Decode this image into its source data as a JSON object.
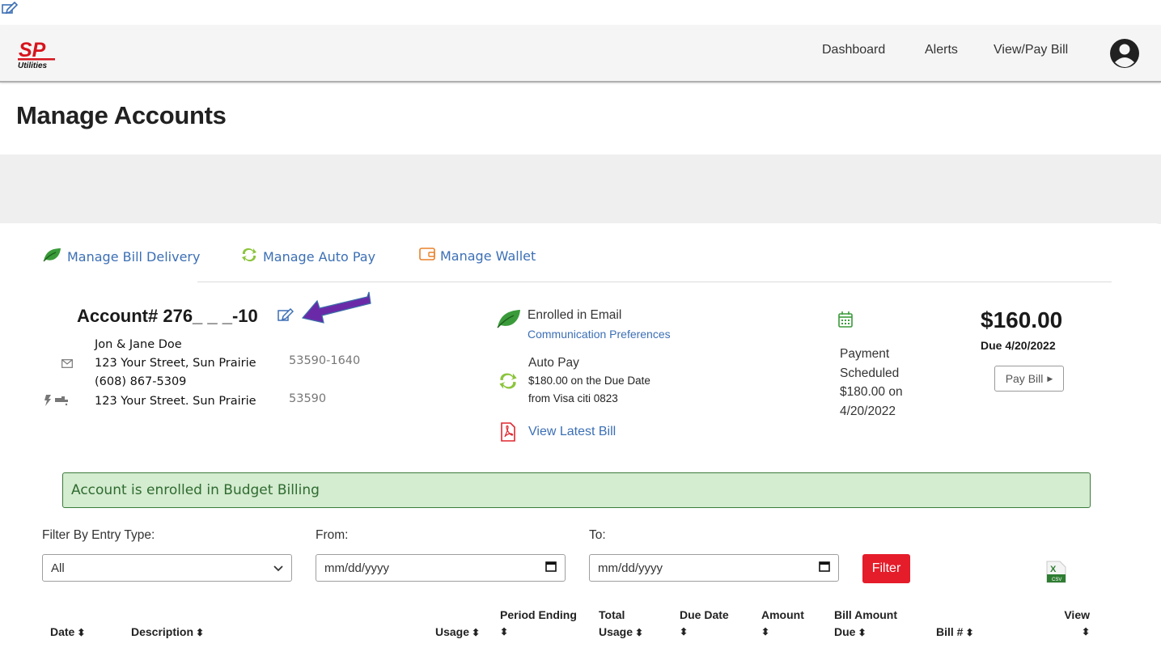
{
  "header": {
    "logo_text_top": "SP",
    "logo_text_bottom": "Utilities",
    "nav": [
      "Dashboard",
      "Alerts",
      "View/Pay Bill"
    ]
  },
  "page": {
    "title": "Manage Accounts"
  },
  "tabs": [
    "Manage Bill Delivery",
    "Manage Auto Pay",
    "Manage Wallet"
  ],
  "account": {
    "number": "Account# 276_ _ _-10",
    "name": "Jon & Jane Doe",
    "mailing_address": "123 Your Street, Sun Prairie",
    "mailing_zip": "53590-1640",
    "phone": "(608) 867-5309",
    "service_address": "123 Your Street. Sun Prairie",
    "service_zip": "53590"
  },
  "status": {
    "enrolled": "Enrolled in Email",
    "comm_prefs": "Communication Preferences",
    "autopay_title": "Auto Pay",
    "autopay_line1": "$180.00 on the Due Date",
    "autopay_line2": "from Visa citi 0823",
    "view_bill": "View Latest Bill"
  },
  "payment": {
    "line1": "Payment",
    "line2": "Scheduled",
    "line3": "$180.00 on",
    "line4": "4/20/2022",
    "amount": "$160.00",
    "due": "Due 4/20/2022",
    "pay_button": "Pay Bill"
  },
  "budget_banner": "Account is enrolled in Budget Billing",
  "filter": {
    "type_label": "Filter By Entry Type:",
    "type_value": "All",
    "from_label": "From:",
    "from_placeholder": "mm/dd/yyyy",
    "to_label": "To:",
    "to_placeholder": "mm/dd/yyyy",
    "button": "Filter",
    "export_icon_text": "X",
    "export_icon_sub": "CSV"
  },
  "table_headers": {
    "date": "Date",
    "description": "Description",
    "usage": "Usage",
    "period_1": "Period Ending",
    "total_1": "Total",
    "total_2": "Usage",
    "due_date": "Due Date",
    "amount": "Amount",
    "bill_amount_1": "Bill Amount",
    "bill_amount_2": "Due",
    "bill_no": "Bill #",
    "view": "View"
  },
  "colors": {
    "link": "#3c6fb5",
    "filter_button": "#e51c2a",
    "banner_bg": "#d4ecd0",
    "arrow": "#6a2aa8"
  }
}
